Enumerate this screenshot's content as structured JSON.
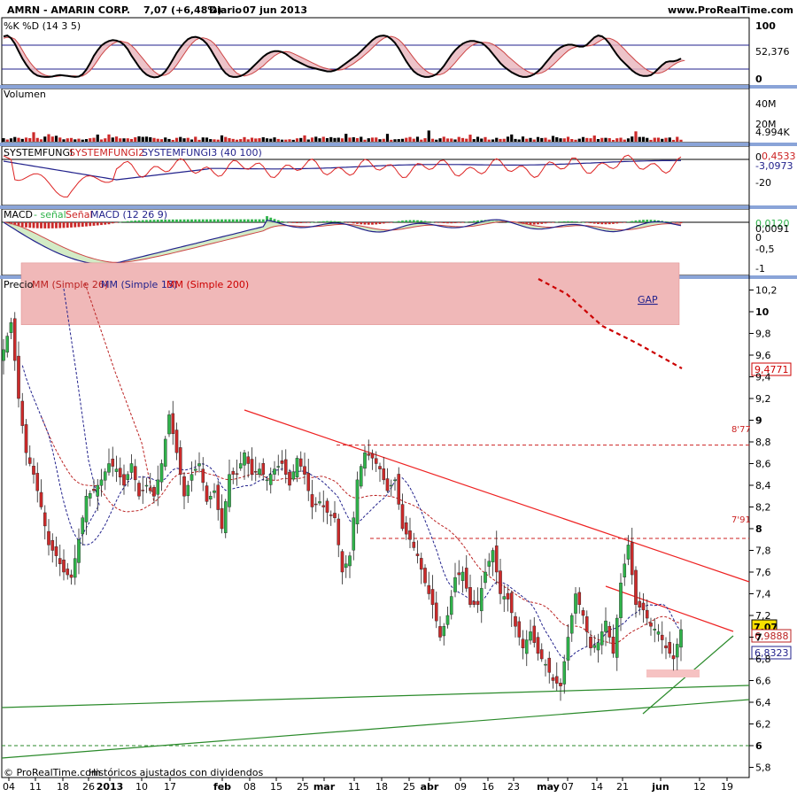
{
  "header": {
    "symbol": "AMRN - AMARIN CORP.",
    "price_change": "7,07 (+6,48%)",
    "period": "Diario",
    "date": "07 jun 2013",
    "site": "www.ProRealTime.com"
  },
  "footer": {
    "copyright": "© ProRealTime.com",
    "note": "Históricos ajustados con dividendos"
  },
  "colors": {
    "separator": "#8aa4d8",
    "up": "#2fb34a",
    "down": "#cc2a2a",
    "ma26": "#bb2222",
    "ma13": "#22228c",
    "ma200": "#cc0000",
    "gap": "#f0b8b8",
    "green_line": "#2a8a2a",
    "red_line": "#ee2222",
    "price_badge": "#f7e000"
  },
  "chart_data": [
    {
      "type": "line",
      "panel": "stochastic",
      "title": "%K %D (14 3 5)",
      "ylim": [
        0,
        100
      ],
      "y_ticks": [
        "100",
        "0"
      ],
      "last_value": "52,376",
      "series": [
        {
          "name": "%K",
          "values": [
            94,
            96,
            90,
            78,
            62,
            46,
            33,
            22,
            14,
            9,
            7,
            6,
            6,
            7,
            9,
            10,
            9,
            8,
            7,
            6,
            7,
            12,
            22,
            36,
            52,
            64,
            74,
            80,
            84,
            86,
            85,
            82,
            76,
            66,
            52,
            40,
            28,
            18,
            11,
            7,
            5,
            6,
            10,
            18,
            30,
            44,
            58,
            70,
            80,
            88,
            92,
            93,
            91,
            86,
            78,
            66,
            52,
            38,
            24,
            14,
            8,
            6,
            6,
            8,
            12,
            18,
            26,
            34,
            42,
            50,
            56,
            60,
            62,
            62,
            60,
            56,
            50,
            44,
            40,
            36,
            32,
            28,
            26,
            24,
            22,
            20,
            18,
            18,
            20,
            24,
            30,
            36,
            42,
            48,
            54,
            62,
            70,
            78,
            86,
            92,
            95,
            96,
            94,
            88,
            80,
            68,
            54,
            40,
            28,
            18,
            12,
            8,
            6,
            6,
            8,
            12,
            20,
            30,
            42,
            54,
            64,
            72,
            78,
            82,
            84,
            84,
            82,
            80,
            74,
            66,
            56,
            46,
            36,
            28,
            22,
            16,
            12,
            8,
            6,
            6,
            8,
            12,
            18,
            26,
            36,
            46,
            56,
            64,
            70,
            74,
            76,
            76,
            74,
            72,
            72,
            76,
            84,
            92,
            96,
            94,
            88,
            78,
            66,
            54,
            44,
            36,
            28,
            20,
            14,
            10,
            8,
            8,
            10,
            16,
            24,
            32,
            38,
            40,
            40,
            42,
            46
          ]
        },
        {
          "name": "%D",
          "values": [
            90,
            92,
            92,
            88,
            78,
            64,
            50,
            38,
            28,
            20,
            14,
            10,
            8,
            7,
            7,
            8,
            9,
            9,
            8,
            8,
            7,
            8,
            13,
            20,
            30,
            42,
            54,
            64,
            72,
            78,
            82,
            84,
            82,
            80,
            74,
            66,
            56,
            46,
            36,
            26,
            18,
            12,
            9,
            10,
            14,
            22,
            32,
            44,
            56,
            68,
            78,
            86,
            90,
            91,
            89,
            85,
            78,
            68,
            56,
            44,
            32,
            22,
            14,
            10,
            8,
            10,
            13,
            18,
            24,
            30,
            38,
            45,
            52,
            57,
            60,
            61,
            60,
            57,
            53,
            49,
            45,
            41,
            37,
            33,
            29,
            26,
            24,
            22,
            21,
            21,
            22,
            25,
            30,
            35,
            41,
            47,
            54,
            61,
            69,
            77,
            84,
            90,
            93,
            94,
            92,
            87,
            79,
            69,
            58,
            47,
            37,
            28,
            21,
            15,
            12,
            10,
            11,
            14,
            20,
            28,
            37,
            47,
            56,
            65,
            72,
            77,
            80,
            81,
            81,
            80,
            77,
            72,
            66,
            59,
            51,
            44,
            37,
            30,
            24,
            19,
            15,
            13,
            13,
            15,
            19,
            25,
            32,
            40,
            48,
            56,
            63,
            68,
            71,
            73,
            73,
            73,
            74,
            77,
            82,
            87,
            90,
            90,
            87,
            82,
            74,
            66,
            57,
            49,
            41,
            34,
            27,
            21,
            17,
            14,
            14,
            16,
            20,
            26,
            32,
            37,
            40,
            42
          ]
        }
      ]
    },
    {
      "type": "bar",
      "panel": "volume",
      "title": "Volumen",
      "y_ticks": [
        "40M",
        "20M"
      ],
      "last_value": "4.994K"
    },
    {
      "type": "line",
      "panel": "systemfungi",
      "title_parts": [
        "SYSTEMFUNGI",
        "SYSTEMFUNGI2",
        "SYSTEMFUNGI3 (40 100)"
      ],
      "y_ticks": [
        "0",
        "-20"
      ],
      "last_values": [
        "0,4533",
        "-3,0973"
      ]
    },
    {
      "type": "bar",
      "panel": "macd",
      "title_parts": [
        "MACD",
        "- señal",
        "Señal",
        "MACD (12 26 9)"
      ],
      "y_ticks": [
        "0",
        "-0,5",
        "-1"
      ],
      "last_values": [
        "0,0120",
        "0,0091"
      ]
    },
    {
      "type": "candlestick",
      "panel": "price",
      "title_parts": [
        "Precio",
        "MM (Simple 26)",
        "MM (Simple 13)",
        "MM (Simple 200)"
      ],
      "ylim": [
        5.7,
        10.3
      ],
      "y_ticks": [
        "10,2",
        "10",
        "9,8",
        "9,6",
        "9,4",
        "9,2",
        "9",
        "8,8",
        "8,6",
        "8,4",
        "8,2",
        "8",
        "7,8",
        "7,6",
        "7,4",
        "7,2",
        "7",
        "6,8",
        "6,6",
        "6,4",
        "6,2",
        "6",
        "5,8"
      ],
      "x_labels": [
        "04",
        "11",
        "18",
        "26",
        "2013",
        "10",
        "17",
        "feb",
        "08",
        "15",
        "25",
        "mar",
        "11",
        "18",
        "25",
        "abr",
        "09",
        "16",
        "23",
        "may",
        "07",
        "14",
        "21",
        "jun",
        "12",
        "19"
      ],
      "last_price": "7,07",
      "price_labels": [
        "9,4771",
        "6,9888",
        "6,8323"
      ],
      "level_labels": [
        "8'77",
        "7'91"
      ],
      "annotation": "GAP",
      "levels": [
        8.77,
        7.91,
        6.0
      ],
      "gap_zone": [
        9.88,
        10.45
      ]
    }
  ]
}
